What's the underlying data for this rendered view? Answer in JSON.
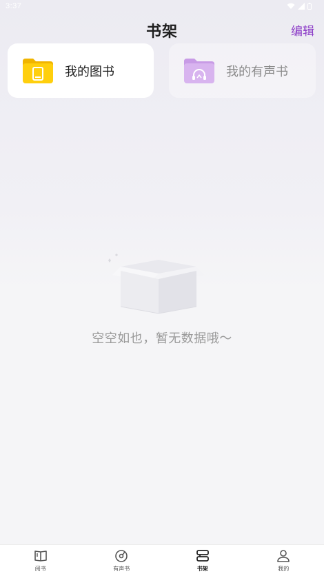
{
  "status_bar": {
    "time": "3:37"
  },
  "header": {
    "title": "书架",
    "edit_label": "编辑"
  },
  "categories": [
    {
      "label": "我的图书",
      "icon": "book-folder-icon",
      "color": "#f5c400"
    },
    {
      "label": "我的有声书",
      "icon": "audio-folder-icon",
      "color": "#cfa8ea"
    }
  ],
  "empty_state": {
    "message": "空空如也，暂无数据哦～",
    "icon": "empty-box-icon"
  },
  "bottom_nav": {
    "active_index": 2,
    "items": [
      {
        "label": "阅书",
        "icon": "open-book-icon"
      },
      {
        "label": "有声书",
        "icon": "vinyl-disc-icon"
      },
      {
        "label": "书架",
        "icon": "bookshelf-icon"
      },
      {
        "label": "我的",
        "icon": "person-icon"
      }
    ]
  },
  "colors": {
    "accent": "#8b3bc7",
    "book_folder": "#f5c400",
    "audio_folder": "#cfa8ea"
  }
}
